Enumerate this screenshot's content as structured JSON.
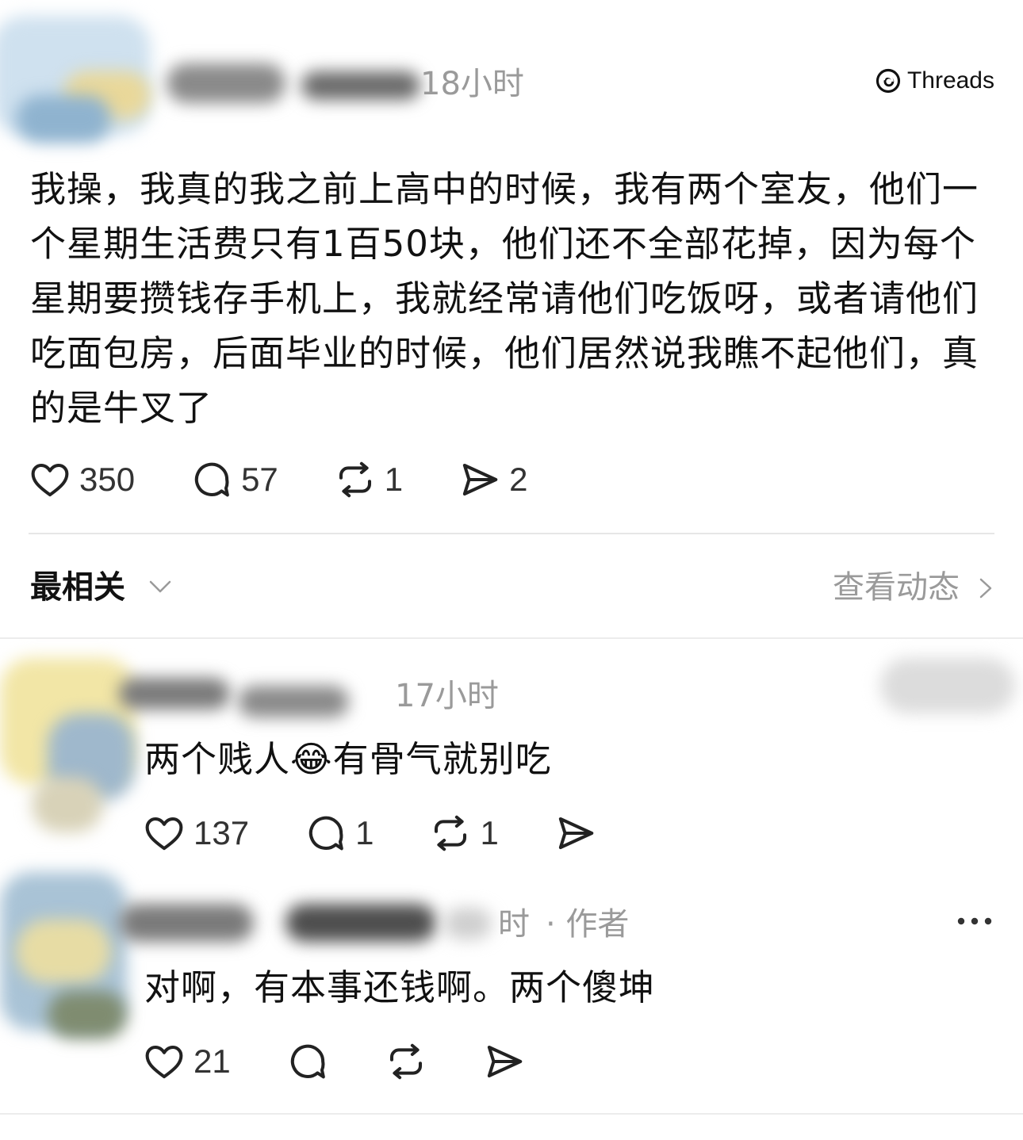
{
  "brand": {
    "name": "Threads"
  },
  "post": {
    "time": "18小时",
    "text": "我操，我真的我之前上高中的时候，我有两个室友，他们一个星期生活费只有1百50块，他们还不全部花掉，因为每个星期要攒钱存手机上，我就经常请他们吃饭呀，或者请他们吃面包房，后面毕业的时候，他们居然说我瞧不起他们，真的是牛叉了",
    "likes": "350",
    "comments": "57",
    "reposts": "1",
    "shares": "2"
  },
  "sort": {
    "label": "最相关",
    "activity_label": "查看动态"
  },
  "replies": [
    {
      "time": "17小时",
      "text_before_emoji": "两个贱人",
      "emoji": "😂",
      "text_after_emoji": "有骨气就别吃",
      "likes": "137",
      "comments": "1",
      "reposts": "1"
    },
    {
      "time_fragment": "时",
      "author_badge": "· 作者",
      "text": "对啊，有本事还钱啊。两个傻坤",
      "likes": "21"
    }
  ]
}
